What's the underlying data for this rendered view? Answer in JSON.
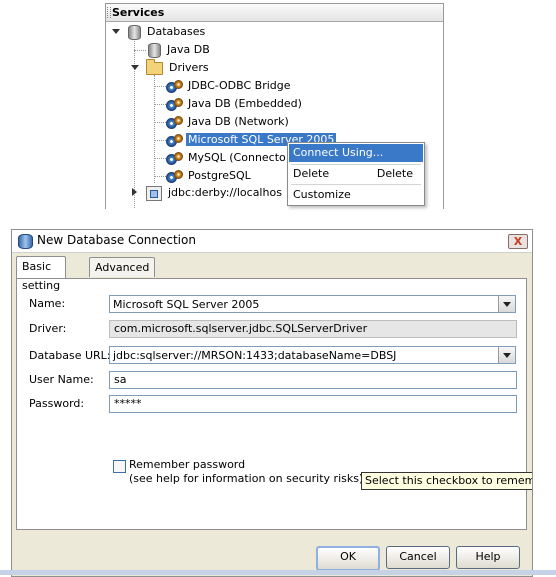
{
  "services": {
    "header": "Services",
    "databases_label": "Databases",
    "java_db_label": "Java DB",
    "drivers_label": "Drivers",
    "drivers": [
      "JDBC-ODBC Bridge",
      "Java DB (Embedded)",
      "Java DB (Network)",
      "Microsoft SQL Server 2005",
      "MySQL (Connecto",
      "PostgreSQL"
    ],
    "connection_label": "jdbc:derby://localhos"
  },
  "context_menu": {
    "connect_using": "Connect Using...",
    "delete": "Delete",
    "delete_shortcut": "Delete",
    "customize": "Customize"
  },
  "dialog": {
    "title": "New Database Connection",
    "close_glyph": "X",
    "tabs": [
      "Basic setting",
      "Advanced"
    ],
    "labels": {
      "name": "Name:",
      "driver": "Driver:",
      "database_url": "Database URL:",
      "user_name": "User Name:",
      "password": "Password:"
    },
    "values": {
      "name": "Microsoft SQL Server 2005",
      "driver": "com.microsoft.sqlserver.jdbc.SQLServerDriver",
      "database_url": "jdbc:sqlserver://MRSON:1433;databaseName=DBSJ",
      "user_name": "sa",
      "password": "*****"
    },
    "remember_password": "Remember password",
    "remember_note": "(see help for information on security risks)",
    "tooltip": "Select this checkbox to remember t",
    "buttons": {
      "ok": "OK",
      "cancel": "Cancel",
      "help": "Help"
    }
  },
  "colors": {
    "selection": "#3a78c8",
    "dialog_bg": "#ece9d8",
    "tooltip_bg": "#ffffe1"
  }
}
